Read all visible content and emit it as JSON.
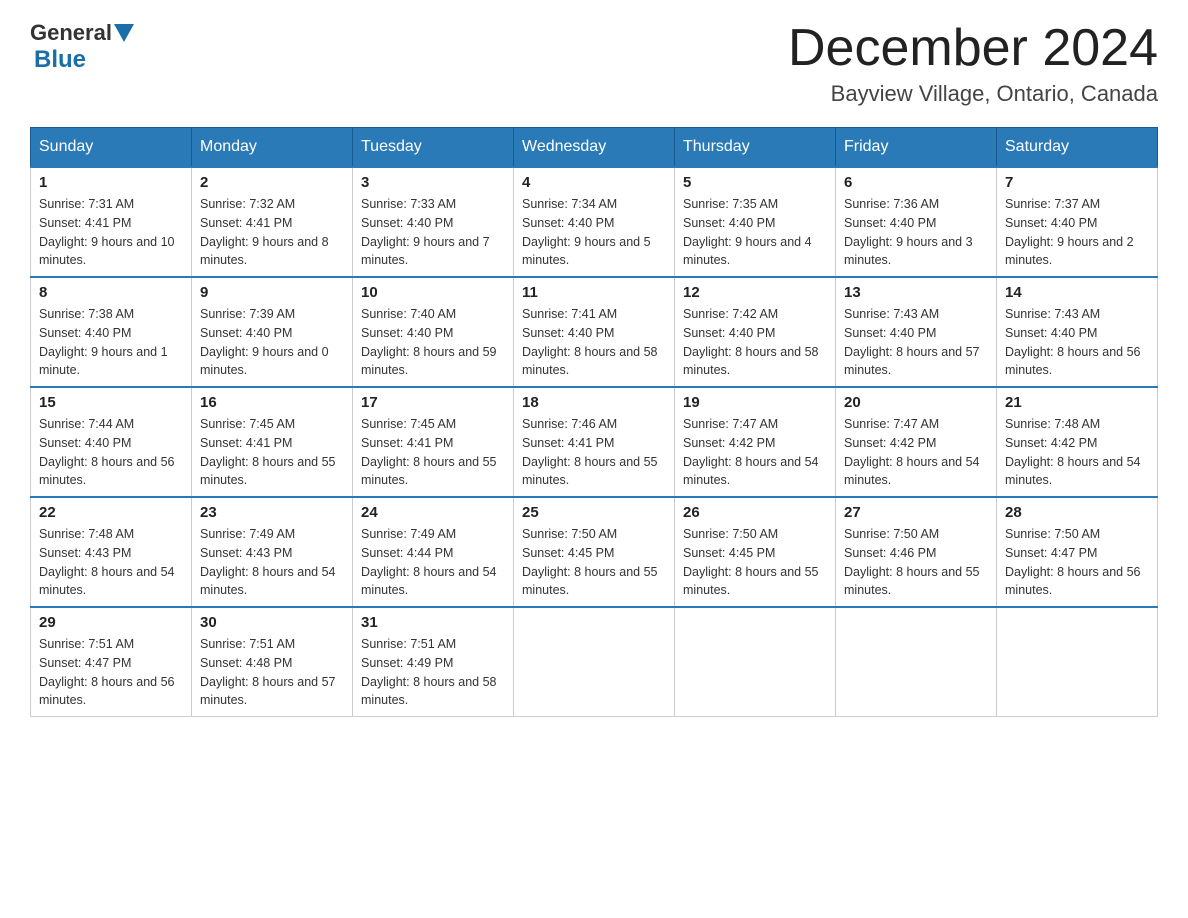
{
  "header": {
    "logo_line1": "General",
    "logo_line2": "Blue",
    "month_title": "December 2024",
    "subtitle": "Bayview Village, Ontario, Canada"
  },
  "weekdays": [
    "Sunday",
    "Monday",
    "Tuesday",
    "Wednesday",
    "Thursday",
    "Friday",
    "Saturday"
  ],
  "weeks": [
    [
      {
        "day": "1",
        "sunrise": "7:31 AM",
        "sunset": "4:41 PM",
        "daylight": "9 hours and 10 minutes."
      },
      {
        "day": "2",
        "sunrise": "7:32 AM",
        "sunset": "4:41 PM",
        "daylight": "9 hours and 8 minutes."
      },
      {
        "day": "3",
        "sunrise": "7:33 AM",
        "sunset": "4:40 PM",
        "daylight": "9 hours and 7 minutes."
      },
      {
        "day": "4",
        "sunrise": "7:34 AM",
        "sunset": "4:40 PM",
        "daylight": "9 hours and 5 minutes."
      },
      {
        "day": "5",
        "sunrise": "7:35 AM",
        "sunset": "4:40 PM",
        "daylight": "9 hours and 4 minutes."
      },
      {
        "day": "6",
        "sunrise": "7:36 AM",
        "sunset": "4:40 PM",
        "daylight": "9 hours and 3 minutes."
      },
      {
        "day": "7",
        "sunrise": "7:37 AM",
        "sunset": "4:40 PM",
        "daylight": "9 hours and 2 minutes."
      }
    ],
    [
      {
        "day": "8",
        "sunrise": "7:38 AM",
        "sunset": "4:40 PM",
        "daylight": "9 hours and 1 minute."
      },
      {
        "day": "9",
        "sunrise": "7:39 AM",
        "sunset": "4:40 PM",
        "daylight": "9 hours and 0 minutes."
      },
      {
        "day": "10",
        "sunrise": "7:40 AM",
        "sunset": "4:40 PM",
        "daylight": "8 hours and 59 minutes."
      },
      {
        "day": "11",
        "sunrise": "7:41 AM",
        "sunset": "4:40 PM",
        "daylight": "8 hours and 58 minutes."
      },
      {
        "day": "12",
        "sunrise": "7:42 AM",
        "sunset": "4:40 PM",
        "daylight": "8 hours and 58 minutes."
      },
      {
        "day": "13",
        "sunrise": "7:43 AM",
        "sunset": "4:40 PM",
        "daylight": "8 hours and 57 minutes."
      },
      {
        "day": "14",
        "sunrise": "7:43 AM",
        "sunset": "4:40 PM",
        "daylight": "8 hours and 56 minutes."
      }
    ],
    [
      {
        "day": "15",
        "sunrise": "7:44 AM",
        "sunset": "4:40 PM",
        "daylight": "8 hours and 56 minutes."
      },
      {
        "day": "16",
        "sunrise": "7:45 AM",
        "sunset": "4:41 PM",
        "daylight": "8 hours and 55 minutes."
      },
      {
        "day": "17",
        "sunrise": "7:45 AM",
        "sunset": "4:41 PM",
        "daylight": "8 hours and 55 minutes."
      },
      {
        "day": "18",
        "sunrise": "7:46 AM",
        "sunset": "4:41 PM",
        "daylight": "8 hours and 55 minutes."
      },
      {
        "day": "19",
        "sunrise": "7:47 AM",
        "sunset": "4:42 PM",
        "daylight": "8 hours and 54 minutes."
      },
      {
        "day": "20",
        "sunrise": "7:47 AM",
        "sunset": "4:42 PM",
        "daylight": "8 hours and 54 minutes."
      },
      {
        "day": "21",
        "sunrise": "7:48 AM",
        "sunset": "4:42 PM",
        "daylight": "8 hours and 54 minutes."
      }
    ],
    [
      {
        "day": "22",
        "sunrise": "7:48 AM",
        "sunset": "4:43 PM",
        "daylight": "8 hours and 54 minutes."
      },
      {
        "day": "23",
        "sunrise": "7:49 AM",
        "sunset": "4:43 PM",
        "daylight": "8 hours and 54 minutes."
      },
      {
        "day": "24",
        "sunrise": "7:49 AM",
        "sunset": "4:44 PM",
        "daylight": "8 hours and 54 minutes."
      },
      {
        "day": "25",
        "sunrise": "7:50 AM",
        "sunset": "4:45 PM",
        "daylight": "8 hours and 55 minutes."
      },
      {
        "day": "26",
        "sunrise": "7:50 AM",
        "sunset": "4:45 PM",
        "daylight": "8 hours and 55 minutes."
      },
      {
        "day": "27",
        "sunrise": "7:50 AM",
        "sunset": "4:46 PM",
        "daylight": "8 hours and 55 minutes."
      },
      {
        "day": "28",
        "sunrise": "7:50 AM",
        "sunset": "4:47 PM",
        "daylight": "8 hours and 56 minutes."
      }
    ],
    [
      {
        "day": "29",
        "sunrise": "7:51 AM",
        "sunset": "4:47 PM",
        "daylight": "8 hours and 56 minutes."
      },
      {
        "day": "30",
        "sunrise": "7:51 AM",
        "sunset": "4:48 PM",
        "daylight": "8 hours and 57 minutes."
      },
      {
        "day": "31",
        "sunrise": "7:51 AM",
        "sunset": "4:49 PM",
        "daylight": "8 hours and 58 minutes."
      },
      null,
      null,
      null,
      null
    ]
  ]
}
